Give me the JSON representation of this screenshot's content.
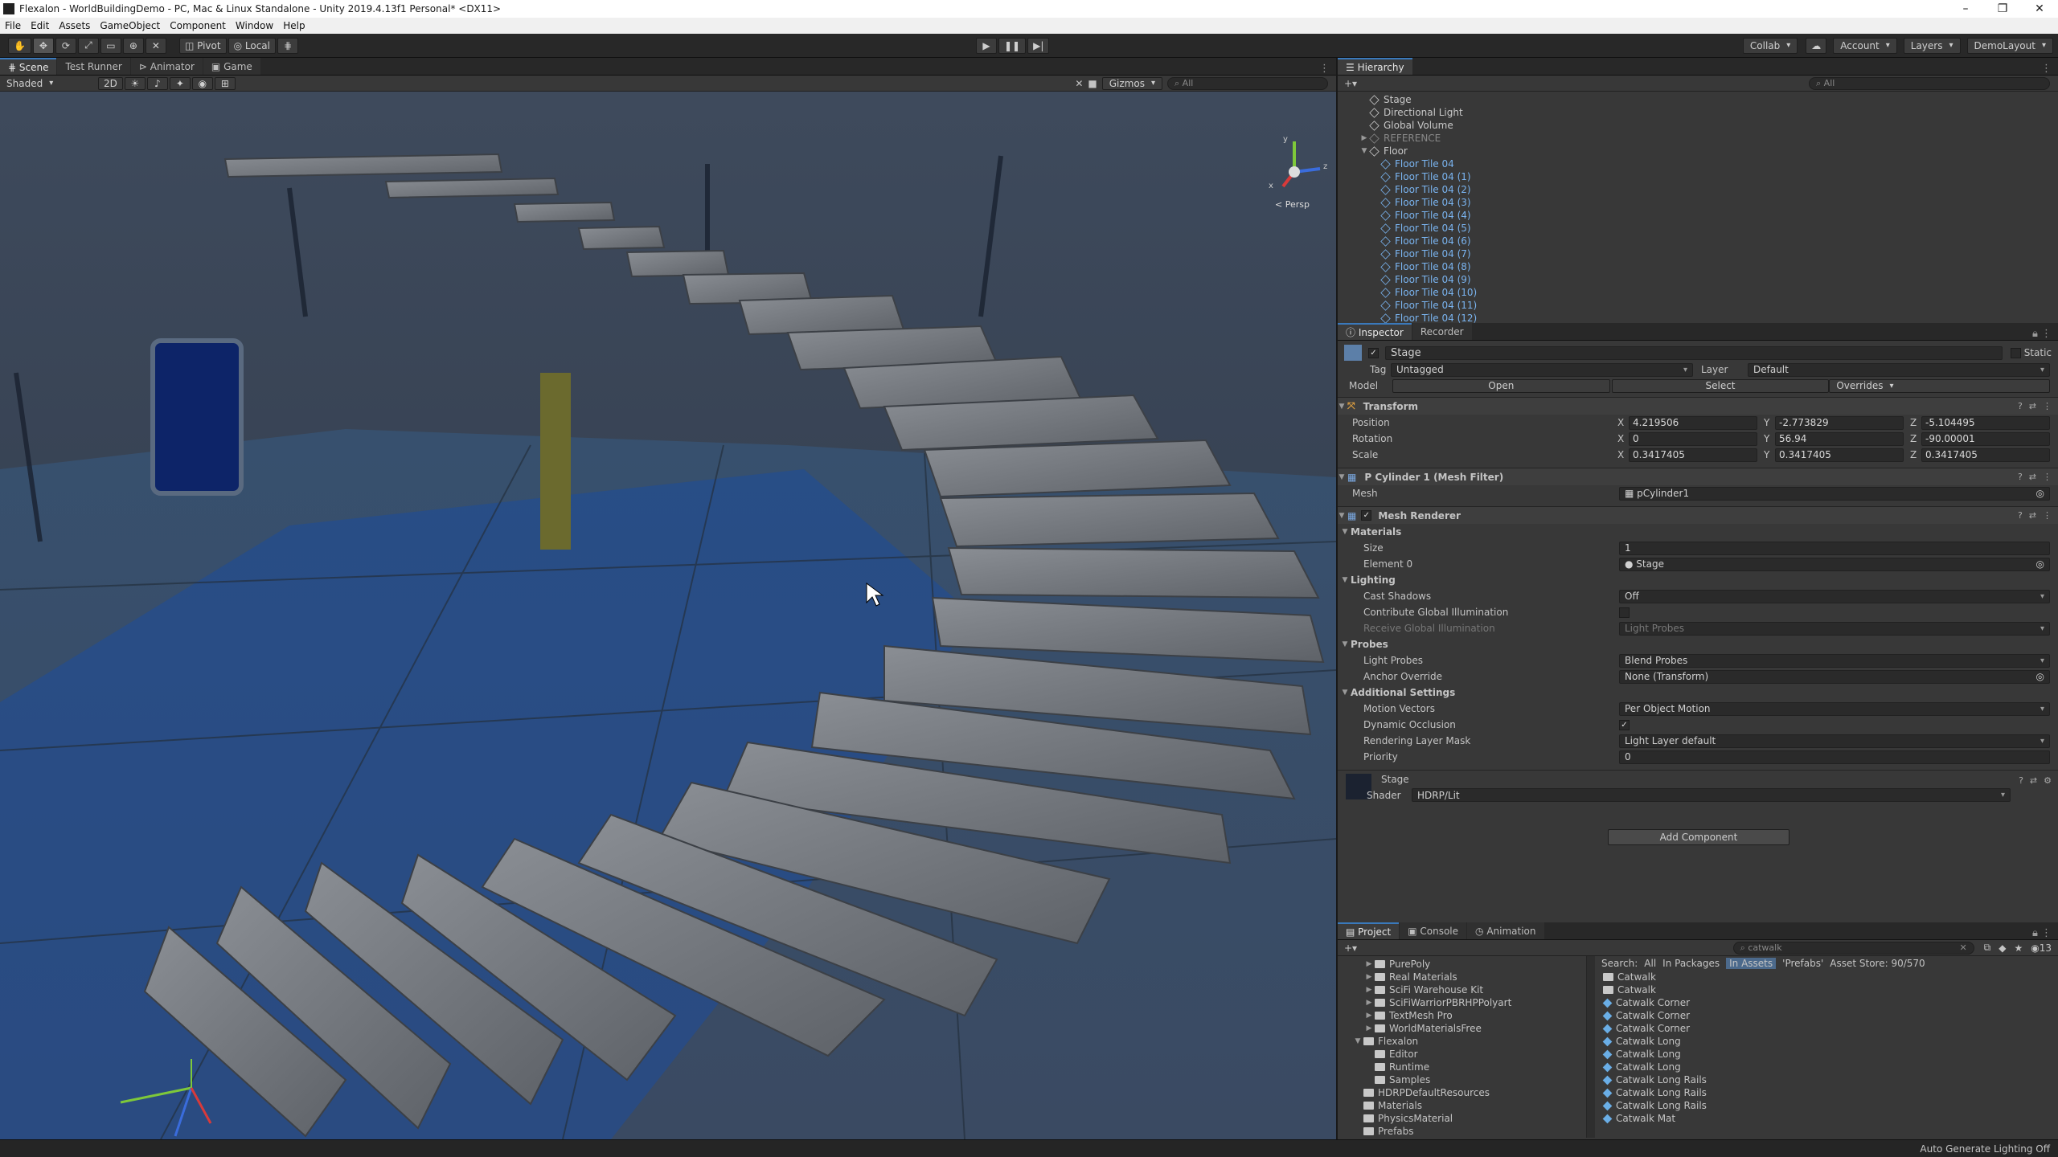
{
  "window": {
    "title": "Flexalon - WorldBuildingDemo - PC, Mac & Linux Standalone - Unity 2019.4.13f1 Personal* <DX11>",
    "min": "–",
    "max": "❐",
    "close": "✕"
  },
  "menu": [
    "File",
    "Edit",
    "Assets",
    "GameObject",
    "Component",
    "Window",
    "Help"
  ],
  "toolbar": {
    "pivot": "Pivot",
    "local": "Local",
    "collab": "Collab",
    "account": "Account",
    "layers": "Layers",
    "layout": "DemoLayout"
  },
  "scene": {
    "tabs": [
      "Scene",
      "Test Runner",
      "Animator",
      "Game"
    ],
    "shading": "Shaded",
    "mode2d": "2D",
    "gizmos": "Gizmos",
    "search_placeholder": "All",
    "persp": "< Persp",
    "axis_x": "x",
    "axis_y": "y",
    "axis_z": "z"
  },
  "hierarchy": {
    "title": "Hierarchy",
    "search_placeholder": "All",
    "rows": [
      {
        "label": "Stage",
        "indent": 2,
        "style": "normal",
        "caret": ""
      },
      {
        "label": "Directional Light",
        "indent": 2,
        "style": "normal",
        "caret": ""
      },
      {
        "label": "Global Volume",
        "indent": 2,
        "style": "normal",
        "caret": ""
      },
      {
        "label": "REFERENCE",
        "indent": 2,
        "style": "grey",
        "caret": "▶"
      },
      {
        "label": "Floor",
        "indent": 2,
        "style": "normal",
        "caret": "▼"
      },
      {
        "label": "Floor Tile 04",
        "indent": 3,
        "style": "blue",
        "caret": ""
      },
      {
        "label": "Floor Tile 04 (1)",
        "indent": 3,
        "style": "blue",
        "caret": ""
      },
      {
        "label": "Floor Tile 04 (2)",
        "indent": 3,
        "style": "blue",
        "caret": ""
      },
      {
        "label": "Floor Tile 04 (3)",
        "indent": 3,
        "style": "blue",
        "caret": ""
      },
      {
        "label": "Floor Tile 04 (4)",
        "indent": 3,
        "style": "blue",
        "caret": ""
      },
      {
        "label": "Floor Tile 04 (5)",
        "indent": 3,
        "style": "blue",
        "caret": ""
      },
      {
        "label": "Floor Tile 04 (6)",
        "indent": 3,
        "style": "blue",
        "caret": ""
      },
      {
        "label": "Floor Tile 04 (7)",
        "indent": 3,
        "style": "blue",
        "caret": ""
      },
      {
        "label": "Floor Tile 04 (8)",
        "indent": 3,
        "style": "blue",
        "caret": ""
      },
      {
        "label": "Floor Tile 04 (9)",
        "indent": 3,
        "style": "blue",
        "caret": ""
      },
      {
        "label": "Floor Tile 04 (10)",
        "indent": 3,
        "style": "blue",
        "caret": ""
      },
      {
        "label": "Floor Tile 04 (11)",
        "indent": 3,
        "style": "blue",
        "caret": ""
      },
      {
        "label": "Floor Tile 04 (12)",
        "indent": 3,
        "style": "blue",
        "caret": ""
      }
    ]
  },
  "inspector": {
    "tabs": [
      "Inspector",
      "Recorder"
    ],
    "object_name": "Stage",
    "static": "Static",
    "tag_label": "Tag",
    "tag": "Untagged",
    "layer_label": "Layer",
    "layer": "Default",
    "model_label": "Model",
    "open": "Open",
    "select": "Select",
    "overrides": "Overrides",
    "transform": {
      "title": "Transform",
      "position": {
        "label": "Position",
        "x": "4.219506",
        "y": "-2.773829",
        "z": "-5.104495"
      },
      "rotation": {
        "label": "Rotation",
        "x": "0",
        "y": "56.94",
        "z": "-90.00001"
      },
      "scale": {
        "label": "Scale",
        "x": "0.3417405",
        "y": "0.3417405",
        "z": "0.3417405"
      }
    },
    "mesh_filter": {
      "title": "P Cylinder 1 (Mesh Filter)",
      "mesh_label": "Mesh",
      "mesh": "pCylinder1"
    },
    "mesh_renderer": {
      "title": "Mesh Renderer",
      "materials": "Materials",
      "size_label": "Size",
      "size": "1",
      "element0_label": "Element 0",
      "element0": "Stage",
      "lighting": "Lighting",
      "cast_shadows_label": "Cast Shadows",
      "cast_shadows": "Off",
      "contribute_gi_label": "Contribute Global Illumination",
      "receive_gi_label": "Receive Global Illumination",
      "receive_gi": "Light Probes",
      "probes": "Probes",
      "light_probes_label": "Light Probes",
      "light_probes": "Blend Probes",
      "anchor_label": "Anchor Override",
      "anchor": "None (Transform)",
      "additional": "Additional Settings",
      "motion_label": "Motion Vectors",
      "motion": "Per Object Motion",
      "dyn_occ_label": "Dynamic Occlusion",
      "rlm_label": "Rendering Layer Mask",
      "rlm": "Light Layer default",
      "priority_label": "Priority",
      "priority": "0"
    },
    "material": {
      "name": "Stage",
      "shader_label": "Shader",
      "shader": "HDRP/Lit"
    },
    "add_component": "Add Component"
  },
  "project": {
    "tabs": [
      "Project",
      "Console",
      "Animation"
    ],
    "search_value": "catwalk",
    "filter_label": "Search:",
    "filters": [
      "All",
      "In Packages",
      "In Assets",
      "'Prefabs'",
      "Asset Store: 90/570"
    ],
    "count": "13",
    "tree": [
      {
        "label": "PurePoly",
        "indent": 1,
        "caret": "▶"
      },
      {
        "label": "Real Materials",
        "indent": 1,
        "caret": "▶"
      },
      {
        "label": "SciFi Warehouse Kit",
        "indent": 1,
        "caret": "▶"
      },
      {
        "label": "SciFiWarriorPBRHPPolyart",
        "indent": 1,
        "caret": "▶"
      },
      {
        "label": "TextMesh Pro",
        "indent": 1,
        "caret": "▶"
      },
      {
        "label": "WorldMaterialsFree",
        "indent": 1,
        "caret": "▶"
      },
      {
        "label": "Flexalon",
        "indent": 0,
        "caret": "▼"
      },
      {
        "label": "Editor",
        "indent": 1,
        "caret": ""
      },
      {
        "label": "Runtime",
        "indent": 1,
        "caret": ""
      },
      {
        "label": "Samples",
        "indent": 1,
        "caret": ""
      },
      {
        "label": "HDRPDefaultResources",
        "indent": 0,
        "caret": ""
      },
      {
        "label": "Materials",
        "indent": 0,
        "caret": ""
      },
      {
        "label": "PhysicsMaterial",
        "indent": 0,
        "caret": ""
      },
      {
        "label": "Prefabs",
        "indent": 0,
        "caret": ""
      }
    ],
    "results": [
      {
        "label": "Catwalk",
        "kind": "folder"
      },
      {
        "label": "Catwalk",
        "kind": "folder"
      },
      {
        "label": "Catwalk Corner",
        "kind": "prefab"
      },
      {
        "label": "Catwalk Corner",
        "kind": "prefab"
      },
      {
        "label": "Catwalk Corner",
        "kind": "prefab"
      },
      {
        "label": "Catwalk Long",
        "kind": "prefab"
      },
      {
        "label": "Catwalk Long",
        "kind": "prefab"
      },
      {
        "label": "Catwalk Long",
        "kind": "prefab"
      },
      {
        "label": "Catwalk Long Rails",
        "kind": "prefab"
      },
      {
        "label": "Catwalk Long Rails",
        "kind": "prefab"
      },
      {
        "label": "Catwalk Long Rails",
        "kind": "prefab"
      },
      {
        "label": "Catwalk Mat",
        "kind": "prefab"
      }
    ]
  },
  "status": {
    "auto_lighting": "Auto Generate Lighting Off"
  },
  "colors": {
    "accent": "#3a79bb",
    "prefab_blue": "#7ab4f0",
    "panel": "#383838"
  }
}
